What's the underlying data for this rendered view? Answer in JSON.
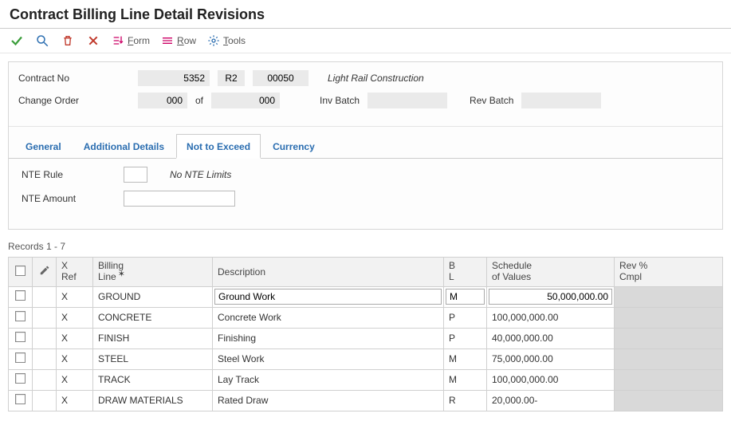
{
  "title": "Contract Billing Line Detail Revisions",
  "toolbar": {
    "form": "Form",
    "row": "Row",
    "tools": "Tools"
  },
  "header": {
    "contract_no_label": "Contract No",
    "contract_no": "5352",
    "contract_sfx1": "R2",
    "contract_sfx2": "00050",
    "contract_desc": "Light Rail Construction",
    "change_order_label": "Change Order",
    "change_order_from": "000",
    "of_label": "of",
    "change_order_to": "000",
    "inv_batch_label": "Inv Batch",
    "inv_batch": "",
    "rev_batch_label": "Rev Batch",
    "rev_batch": ""
  },
  "tabs": {
    "general": "General",
    "additional": "Additional Details",
    "nte": "Not to Exceed",
    "currency": "Currency"
  },
  "nte": {
    "rule_label": "NTE Rule",
    "rule_value": "",
    "rule_desc": "No NTE Limits",
    "amount_label": "NTE Amount",
    "amount_value": ""
  },
  "grid": {
    "records_label": "Records 1 - 7",
    "columns": {
      "xref": "X\nRef",
      "billing_line": "Billing\nLine",
      "description": "Description",
      "bl": "B\nL",
      "sov": "Schedule\nof Values",
      "rev": "Rev %\nCmpl"
    },
    "rows": [
      {
        "xref": "X",
        "billing_line": "GROUND",
        "description": "Ground Work",
        "bl": "M",
        "sov": "50,000,000.00",
        "selected": true
      },
      {
        "xref": "X",
        "billing_line": "CONCRETE",
        "description": "Concrete Work",
        "bl": "P",
        "sov": "100,000,000.00"
      },
      {
        "xref": "X",
        "billing_line": "FINISH",
        "description": "Finishing",
        "bl": "P",
        "sov": "40,000,000.00"
      },
      {
        "xref": "X",
        "billing_line": "STEEL",
        "description": "Steel Work",
        "bl": "M",
        "sov": "75,000,000.00"
      },
      {
        "xref": "X",
        "billing_line": "TRACK",
        "description": "Lay Track",
        "bl": "M",
        "sov": "100,000,000.00"
      },
      {
        "xref": "X",
        "billing_line": "DRAW MATERIALS",
        "description": "Rated Draw",
        "bl": "R",
        "sov": "20,000.00-"
      }
    ]
  }
}
